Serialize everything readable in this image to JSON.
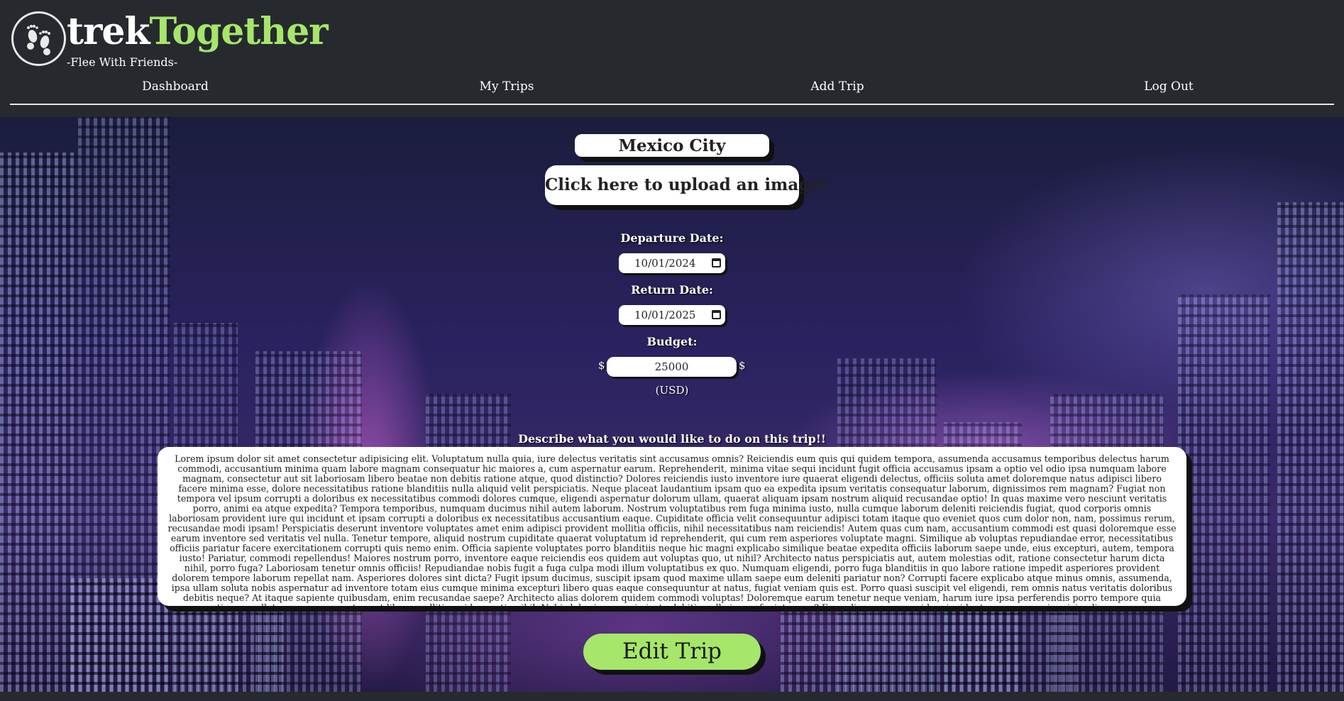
{
  "header": {
    "brand_part1": "trek",
    "brand_part2": "Together",
    "tagline": "-Flee With Friends-",
    "logo_icon": "footprints-icon"
  },
  "nav": [
    {
      "label": "Dashboard"
    },
    {
      "label": "My Trips"
    },
    {
      "label": "Add Trip"
    },
    {
      "label": "Log Out"
    }
  ],
  "trip": {
    "destination": "Mexico City",
    "upload_label": "Click here to upload an image!",
    "departure_label": "Departure Date:",
    "departure_value": "10/01/2024",
    "return_label": "Return Date:",
    "return_value": "10/01/2025",
    "budget_label": "Budget:",
    "currency_symbol": "$",
    "budget_value": "25000",
    "currency_note": "(USD)",
    "description_label": "Describe what you would like to do on this trip!!",
    "description": "Lorem ipsum dolor sit amet consectetur adipisicing elit. Voluptatum nulla quia, iure delectus veritatis sint accusamus omnis? Reiciendis eum quis qui quidem tempora, assumenda accusamus temporibus delectus harum commodi, accusantium minima quam labore magnam consequatur hic maiores a, cum aspernatur earum. Reprehenderit, minima vitae sequi incidunt fugit officia accusamus ipsam a optio vel odio ipsa numquam labore magnam, consectetur aut sit laboriosam libero beatae non debitis ratione atque, quod distinctio? Dolores reiciendis iusto inventore iure quaerat eligendi delectus, officiis soluta amet doloremque natus adipisci libero facere minima esse, dolore necessitatibus ratione blanditiis nulla aliquid velit perspiciatis. Neque placeat laudantium ipsam quo ea expedita ipsum veritatis consequatur laborum, dignissimos rem magnam? Fugiat non tempora vel ipsum corrupti a doloribus ex necessitatibus commodi dolores cumque, eligendi aspernatur dolorum ullam, quaerat aliquam ipsam nostrum aliquid recusandae optio! In quas maxime vero nesciunt veritatis porro, animi ea atque expedita? Tempora temporibus, numquam ducimus nihil autem laborum. Nostrum voluptatibus rem fuga minima iusto, nulla cumque laborum deleniti reiciendis fugiat, quod corporis omnis laboriosam provident iure qui incidunt et ipsam corrupti a doloribus ex necessitatibus accusantium eaque. Cupiditate officia velit consequuntur adipisci totam itaque quo eveniet quos cum dolor non, nam, possimus rerum, recusandae modi ipsam! Perspiciatis deserunt inventore voluptates amet enim adipisci provident mollitia officiis, nihil necessitatibus nam reiciendis! Autem quas cum nam, accusantium commodi est quasi doloremque esse earum inventore sed veritatis vel nulla. Tenetur tempore, aliquid nostrum cupiditate quaerat voluptatum id reprehenderit, qui cum rem asperiores voluptate magni. Similique ab voluptas repudiandae error, necessitatibus officiis pariatur facere exercitationem corrupti quis nemo enim. Officia sapiente voluptates porro blanditiis neque hic magni explicabo similique beatae expedita officiis laborum saepe unde, eius excepturi, autem, tempora iusto! Pariatur, commodi repellendus! Maiores nostrum porro, inventore eaque reiciendis eos quidem aut voluptas quo, ut nihil? Architecto natus perspiciatis aut, autem molestias odit, ratione consectetur harum dicta nihil, porro fuga? Laboriosam tenetur omnis officiis! Repudiandae nobis fugit a fuga culpa modi illum voluptatibus ex quo. Numquam eligendi, porro fuga blanditiis in quo labore ratione impedit asperiores provident dolorem tempore laborum repellat nam. Asperiores dolores sint dicta? Fugit ipsum ducimus, suscipit ipsam quod maxime ullam saepe eum deleniti pariatur non? Corrupti facere explicabo atque minus omnis, assumenda, ipsa ullam soluta nobis aspernatur ad inventore totam eius cumque minima excepturi libero quas eaque consequuntur at natus, fugiat veniam quis est. Porro quasi suscipit vel eligendi, rem omnis natus veritatis doloribus debitis neque? At itaque sapiente quibusdam, enim recusandae saepe? Architecto alias dolorem quidem commodi voluptas! Doloremque earum tenetur neque veniam, harum iure ipsa perferendis porro tempore quia praesentium repellat, cum consequuntur aut libero mollitia quidem optio nihil. Nobis laboriosam quia iusto debitis nulla ipsam fugiat quam? Esse aliquam quae quidem incidunt rerum corporis reiciendis earum saepe consectetur odio ab",
    "edit_label": "Edit Trip"
  },
  "colors": {
    "header_bg": "#262a2f",
    "brand_accent": "#a6e66a",
    "button_green": "#a6e66a"
  }
}
